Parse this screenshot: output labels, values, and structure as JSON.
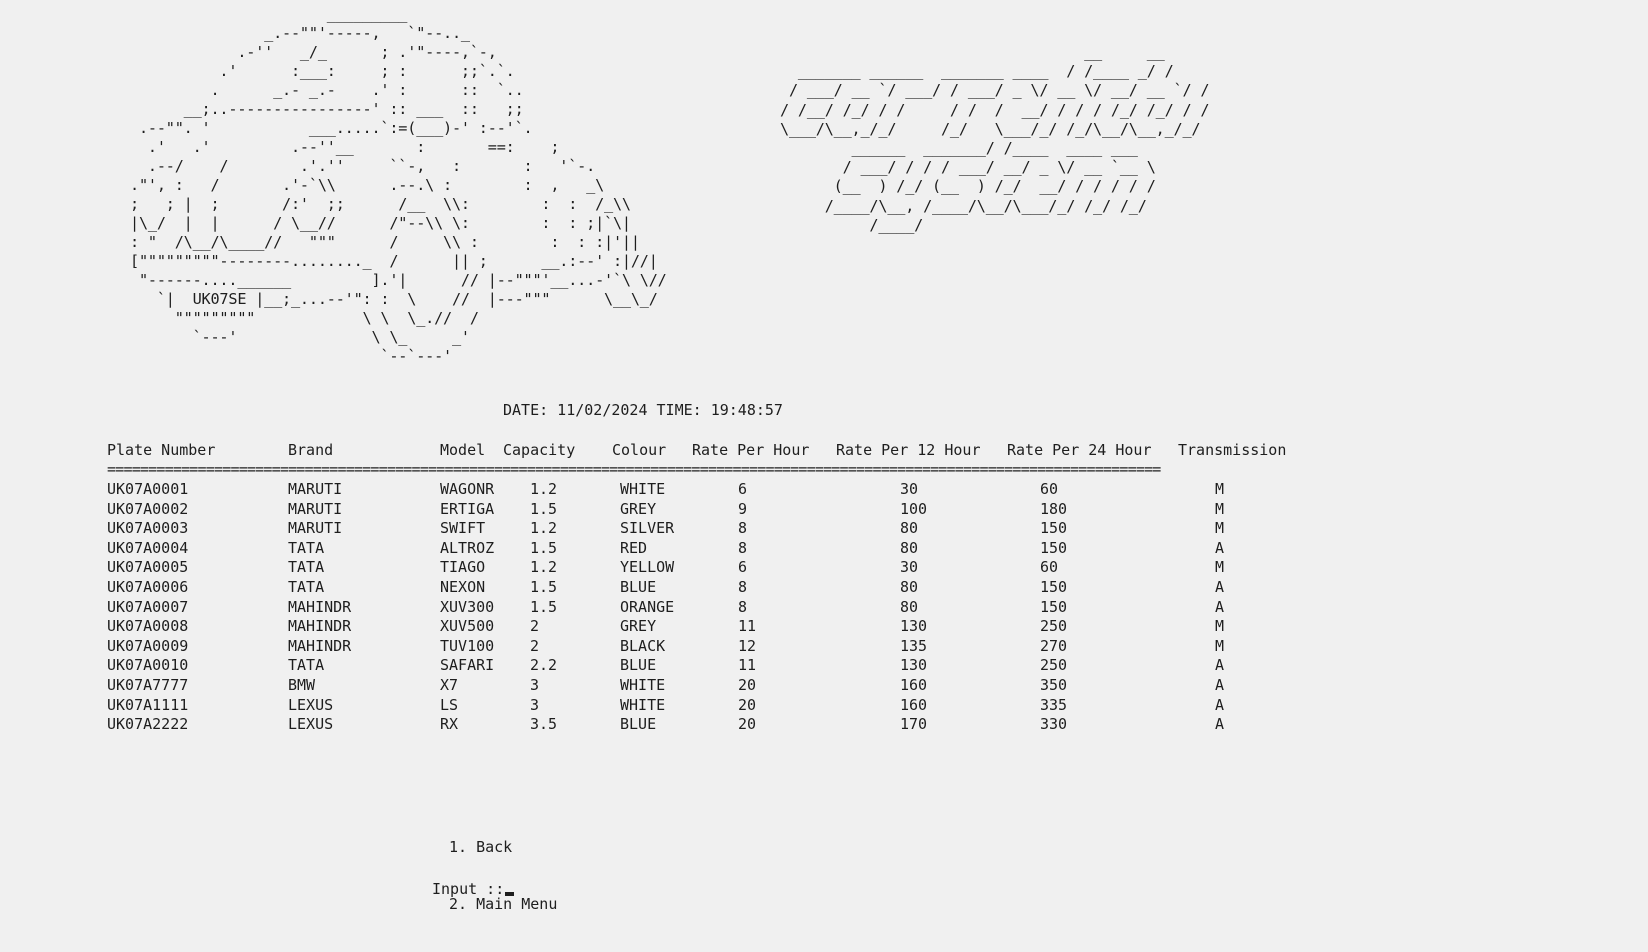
{
  "car_art": "                      _________\n               _.--\"\"'-----,   `\"--.._\n            .-''   _/_      ; .'\"----,`-,\n          .'      :___:     ; :      ;;`.`.\n         .      _.- _.-    .' :      ::  `..\n      __;..----------------' :: ___  ::   ;;\n .--\"\". '           ___.....`:=(___)-' :--'`.\n  .'   .'         .--''__       :       ==:    ;\n  .--/    /        .'.''     ``-,   :       :   '`-.\n.\"', :   /       .'-`\\\\      .--.\\ :        :  ,   _\\\n;   ; |  ;       /:'  ;;      /__  \\\\:        :  :  /_\\\\\n|\\_/  |  |      / \\__//      /\"--\\\\ \\:        :  : ;|`\\|\n: \"  /\\__/\\____//   \"\"\"      /     \\\\ :        :  : :|'||\n[\"\"\"\"\"\"\"\"\"--------........_  /      || ;      __.:--' :|//|\n \"------....______         ].'|      // |--\"\"\"'__...-'`\\ \\//\n   `|  UK07SE |__;_...--'\": :  \\    //  |---\"\"\"      \\__\\_/\n     \"\"\"\"\"\"\"\"\"            \\ \\  \\_.//  /\n       `---'               \\ \\_     _'\n                            `--`---'",
  "title_art": "                                  __     __\n  _______ ______  _______ ____  / /____ _/ /\n / ___/ __ `/ ___/ / ___/ _ \\/ __ \\/ __/ __ `/ /\n/ /__/ /_/ / /     / /  /  __/ / / / /_/ /_/ / /\n\\___/\\__,_/_/     /_/   \\___/_/ /_/\\__/\\__,_/_/\n        ______  _______/ /____  ____ ___\n       / ___/ / / / ___/ __/ _ \\/ __ `__ \\\n      (__  ) /_/ (__  ) /_/  __/ / / / / /\n     /____/\\__, /____/\\__/\\___/_/ /_/ /_/\n          /____/",
  "datetime": "DATE: 11/02/2024 TIME: 19:48:57",
  "table": {
    "columns": [
      "Plate Number",
      "Brand",
      "Model",
      "Capacity",
      "Colour",
      "Rate Per Hour",
      "Rate Per 12 Hour",
      "Rate Per 24 Hour",
      "Transmission"
    ],
    "separator": "================================================================================================================================",
    "rows": [
      [
        "UK07A0001",
        "MARUTI",
        "WAGONR",
        "1.2",
        "WHITE",
        "6",
        "30",
        "60",
        "M"
      ],
      [
        "UK07A0002",
        "MARUTI",
        "ERTIGA",
        "1.5",
        "GREY",
        "9",
        "100",
        "180",
        "M"
      ],
      [
        "UK07A0003",
        "MARUTI",
        "SWIFT",
        "1.2",
        "SILVER",
        "8",
        "80",
        "150",
        "M"
      ],
      [
        "UK07A0004",
        "TATA",
        "ALTROZ",
        "1.5",
        "RED",
        "8",
        "80",
        "150",
        "A"
      ],
      [
        "UK07A0005",
        "TATA",
        "TIAGO",
        "1.2",
        "YELLOW",
        "6",
        "30",
        "60",
        "M"
      ],
      [
        "UK07A0006",
        "TATA",
        "NEXON",
        "1.5",
        "BLUE",
        "8",
        "80",
        "150",
        "A"
      ],
      [
        "UK07A0007",
        "MAHINDR",
        "XUV300",
        "1.5",
        "ORANGE",
        "8",
        "80",
        "150",
        "A"
      ],
      [
        "UK07A0008",
        "MAHINDR",
        "XUV500",
        "2",
        "GREY",
        "11",
        "130",
        "250",
        "M"
      ],
      [
        "UK07A0009",
        "MAHINDR",
        "TUV100",
        "2",
        "BLACK",
        "12",
        "135",
        "270",
        "M"
      ],
      [
        "UK07A0010",
        "TATA",
        "SAFARI",
        "2.2",
        "BLUE",
        "11",
        "130",
        "250",
        "A"
      ],
      [
        "UK07A7777",
        "BMW",
        "X7",
        "3",
        "WHITE",
        "20",
        "160",
        "350",
        "A"
      ],
      [
        "UK07A1111",
        "LEXUS",
        "LS",
        "3",
        "WHITE",
        "20",
        "160",
        "335",
        "A"
      ],
      [
        "UK07A2222",
        "LEXUS",
        "RX",
        "3.5",
        "BLUE",
        "20",
        "170",
        "330",
        "A"
      ]
    ]
  },
  "menu": {
    "items": [
      "1. Back",
      "2. Main Menu"
    ]
  },
  "prompt": {
    "label": "Input ::"
  }
}
